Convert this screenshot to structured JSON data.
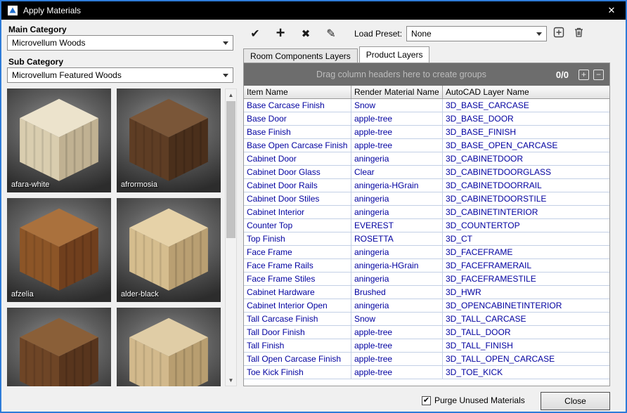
{
  "window": {
    "title": "Apply Materials",
    "close_glyph": "✕"
  },
  "left": {
    "main_category_label": "Main Category",
    "main_category_value": "Microvellum Woods",
    "sub_category_label": "Sub Category",
    "sub_category_value": "Microvellum Featured Woods",
    "thumbnails": [
      {
        "label": "afara-white",
        "top": "#ece3cc",
        "front": "#d9cdaf",
        "side": "#c0b192"
      },
      {
        "label": "afrormosia",
        "top": "#7a5638",
        "front": "#5e3d24",
        "side": "#4a2f1b"
      },
      {
        "label": "afzelia",
        "top": "#aa713d",
        "front": "#8c5527",
        "side": "#703f1d"
      },
      {
        "label": "alder-black",
        "top": "#e6d2a8",
        "front": "#d5bd8e",
        "side": "#b99f72"
      },
      {
        "label": "",
        "top": "#8a5f38",
        "front": "#6e4526",
        "side": "#58351d"
      },
      {
        "label": "",
        "top": "#e0cda6",
        "front": "#d2b98c",
        "side": "#b89e70"
      }
    ]
  },
  "toolbar": {
    "apply_glyph": "✔",
    "add_glyph": "+",
    "delete_glyph": "✖",
    "edit_glyph": "✎",
    "load_preset_label": "Load Preset:",
    "preset_value": "None"
  },
  "tabs": {
    "room_components": "Room Components Layers",
    "product_layers": "Product Layers"
  },
  "grid": {
    "group_hint": "Drag column headers here to create groups",
    "counter": "0/0",
    "expand_glyph": "+",
    "collapse_glyph": "−",
    "columns": [
      "Item Name",
      "Render Material Name",
      "AutoCAD Layer Name"
    ],
    "rows": [
      [
        "Base Carcase Finish",
        "Snow",
        "3D_BASE_CARCASE"
      ],
      [
        "Base Door",
        "apple-tree",
        "3D_BASE_DOOR"
      ],
      [
        "Base Finish",
        "apple-tree",
        "3D_BASE_FINISH"
      ],
      [
        "Base Open Carcase Finish",
        "apple-tree",
        "3D_BASE_OPEN_CARCASE"
      ],
      [
        "Cabinet Door",
        "aningeria",
        "3D_CABINETDOOR"
      ],
      [
        "Cabinet Door Glass",
        "Clear",
        "3D_CABINETDOORGLASS"
      ],
      [
        "Cabinet Door Rails",
        "aningeria-HGrain",
        "3D_CABINETDOORRAIL"
      ],
      [
        "Cabinet Door Stiles",
        "aningeria",
        "3D_CABINETDOORSTILE"
      ],
      [
        "Cabinet Interior",
        "aningeria",
        "3D_CABINETINTERIOR"
      ],
      [
        "Counter Top",
        "EVEREST",
        "3D_COUNTERTOP"
      ],
      [
        "Top Finish",
        "ROSETTA",
        "3D_CT"
      ],
      [
        "Face Frame",
        "aningeria",
        "3D_FACEFRAME"
      ],
      [
        "Face Frame Rails",
        "aningeria-HGrain",
        "3D_FACEFRAMERAIL"
      ],
      [
        "Face Frame Stiles",
        "aningeria",
        "3D_FACEFRAMESTILE"
      ],
      [
        "Cabinet Hardware",
        "Brushed",
        "3D_HWR"
      ],
      [
        "Cabinet Interior Open",
        "aningeria",
        "3D_OPENCABINETINTERIOR"
      ],
      [
        "Tall Carcase Finish",
        "Snow",
        "3D_TALL_CARCASE"
      ],
      [
        "Tall Door Finish",
        "apple-tree",
        "3D_TALL_DOOR"
      ],
      [
        "Tall Finish",
        "apple-tree",
        "3D_TALL_FINISH"
      ],
      [
        "Tall Open Carcase Finish",
        "apple-tree",
        "3D_TALL_OPEN_CARCASE"
      ],
      [
        "Toe Kick Finish",
        "apple-tree",
        "3D_TOE_KICK"
      ]
    ]
  },
  "footer": {
    "purge_label": "Purge Unused Materials",
    "purge_checked": "✔",
    "close_label": "Close"
  }
}
